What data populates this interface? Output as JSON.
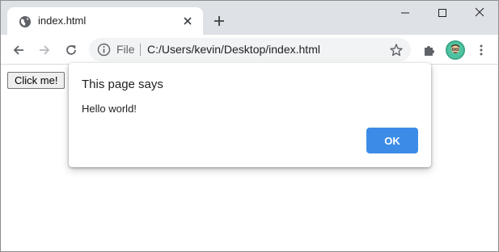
{
  "tab": {
    "title": "index.html"
  },
  "addressbar": {
    "scheme_label": "File",
    "url": "C:/Users/kevin/Desktop/index.html"
  },
  "page": {
    "button_label": "Click me!"
  },
  "dialog": {
    "title": "This page says",
    "message": "Hello world!",
    "ok_label": "OK"
  },
  "colors": {
    "tabstrip": "#dee1e6",
    "omnibox": "#f1f3f4",
    "dialog_ok": "#3c8ce7",
    "avatar": "#4fc3a1"
  },
  "icons": {
    "tab_favicon": "globe-icon",
    "tab_close": "close-icon",
    "new_tab": "plus-icon",
    "back": "arrow-left-icon",
    "forward": "arrow-right-icon",
    "reload": "reload-icon",
    "site_info": "info-icon",
    "bookmark": "star-icon",
    "extensions": "puzzle-icon",
    "menu": "kebab-menu-icon"
  }
}
